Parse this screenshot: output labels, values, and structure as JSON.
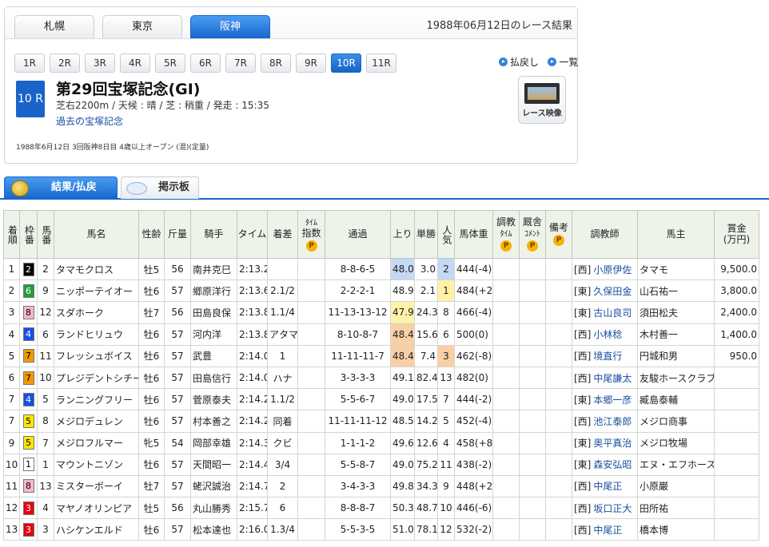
{
  "header": {
    "track_tabs": [
      {
        "label": "札幌",
        "active": false
      },
      {
        "label": "東京",
        "active": false
      },
      {
        "label": "阪神",
        "active": true
      }
    ],
    "result_date": "1988年06月12日のレース結果"
  },
  "race_nav": {
    "races": [
      "1R",
      "2R",
      "3R",
      "4R",
      "5R",
      "6R",
      "7R",
      "8R",
      "9R",
      "10R",
      "11R"
    ],
    "active_race": "10R",
    "payout_link": "払戻し",
    "list_link": "一覧"
  },
  "race": {
    "number": "10 R",
    "title": "第29回宝塚記念(GI)",
    "info": "芝右2200m / 天候 : 晴 / 芝 : 稍重 / 発走 : 15:35",
    "past_link": "過去の宝塚記念",
    "footer": "1988年6月12日 3回阪神8日目 4歳以上オープン (混)(定量)",
    "video_label": "レース映像"
  },
  "result_tabs": {
    "results": "結果/払戻",
    "board": "掲示板"
  },
  "table": {
    "headers": {
      "rank": "着順",
      "waku": "枠番",
      "umaban": "馬番",
      "horse": "馬名",
      "sexage": "性齢",
      "weight": "斤量",
      "jockey": "騎手",
      "time": "タイム",
      "margin": "着差",
      "time_index_1": "ﾀｲﾑ",
      "time_index_2": "指数",
      "passing": "通過",
      "last3f": "上り",
      "odds": "単勝",
      "pop": "人気",
      "body": "馬体重",
      "train_time_1": "調教",
      "train_time_2": "ﾀｲﾑ",
      "comment_1": "厩舎",
      "comment_2": "ｺﾒﾝﾄ",
      "remarks": "備考",
      "trainer": "調教師",
      "owner": "馬主",
      "prize_1": "賞金",
      "prize_2": "(万円)",
      "premium_badge": "P"
    },
    "waku_colors": {
      "1": {
        "bg": "#ffffff",
        "fg": "#000000"
      },
      "2": {
        "bg": "#000000",
        "fg": "#ffffff"
      },
      "3": {
        "bg": "#e60012",
        "fg": "#ffffff"
      },
      "4": {
        "bg": "#1450e6",
        "fg": "#ffffff"
      },
      "5": {
        "bg": "#ffe500",
        "fg": "#000000"
      },
      "6": {
        "bg": "#1e9e3a",
        "fg": "#ffffff"
      },
      "7": {
        "bg": "#f39800",
        "fg": "#000000"
      },
      "8": {
        "bg": "#f7b7c8",
        "fg": "#000000"
      }
    },
    "highlight_colors": {
      "blue": "#c5d9f5",
      "yellow": "#fff2a8",
      "orange": "#f9cfa6"
    },
    "rows": [
      {
        "rank": "1",
        "waku": "2",
        "umaban": "2",
        "horse": "タマモクロス",
        "sexage": "牡5",
        "weight": "56",
        "jockey": "南井克巳",
        "time": "2:13.2",
        "margin": "",
        "passing": "8-8-6-5",
        "last3f": "48.0",
        "last3f_hl": "blue",
        "odds": "3.0",
        "pop": "2",
        "pop_hl": "blue",
        "body": "444(-4)",
        "region": "[西]",
        "trainer": "小原伊佐",
        "owner": "タマモ",
        "prize": "9,500.0"
      },
      {
        "rank": "2",
        "waku": "6",
        "umaban": "9",
        "horse": "ニッポーテイオー",
        "sexage": "牡6",
        "weight": "57",
        "jockey": "郷原洋行",
        "time": "2:13.6",
        "margin": "2.1/2",
        "passing": "2-2-2-1",
        "last3f": "48.9",
        "last3f_hl": "",
        "odds": "2.1",
        "pop": "1",
        "pop_hl": "yellow",
        "body": "484(+2)",
        "region": "[東]",
        "trainer": "久保田金",
        "owner": "山石祐一",
        "prize": "3,800.0"
      },
      {
        "rank": "3",
        "waku": "8",
        "umaban": "12",
        "horse": "スダホーク",
        "sexage": "牡7",
        "weight": "56",
        "jockey": "田島良保",
        "time": "2:13.8",
        "margin": "1.1/4",
        "passing": "11-13-13-12",
        "last3f": "47.9",
        "last3f_hl": "yellow",
        "odds": "24.3",
        "pop": "8",
        "pop_hl": "",
        "body": "466(-4)",
        "region": "[東]",
        "trainer": "古山良司",
        "owner": "須田松夫",
        "prize": "2,400.0"
      },
      {
        "rank": "4",
        "waku": "4",
        "umaban": "6",
        "horse": "ランドヒリュウ",
        "sexage": "牡6",
        "weight": "57",
        "jockey": "河内洋",
        "time": "2:13.8",
        "margin": "アタマ",
        "passing": "8-10-8-7",
        "last3f": "48.4",
        "last3f_hl": "orange",
        "odds": "15.6",
        "pop": "6",
        "pop_hl": "",
        "body": "500(0)",
        "region": "[西]",
        "trainer": "小林稔",
        "owner": "木村善一",
        "prize": "1,400.0"
      },
      {
        "rank": "5",
        "waku": "7",
        "umaban": "11",
        "horse": "フレッシュボイス",
        "sexage": "牡6",
        "weight": "57",
        "jockey": "武豊",
        "time": "2:14.0",
        "margin": "1",
        "passing": "11-11-11-7",
        "last3f": "48.4",
        "last3f_hl": "orange",
        "odds": "7.4",
        "pop": "3",
        "pop_hl": "orange",
        "body": "462(-8)",
        "region": "[西]",
        "trainer": "境直行",
        "owner": "円城和男",
        "prize": "950.0"
      },
      {
        "rank": "6",
        "waku": "7",
        "umaban": "10",
        "horse": "プレジデントシチー",
        "sexage": "牡6",
        "weight": "57",
        "jockey": "田島信行",
        "time": "2:14.0",
        "margin": "ハナ",
        "passing": "3-3-3-3",
        "last3f": "49.1",
        "last3f_hl": "",
        "odds": "82.4",
        "pop": "13",
        "pop_hl": "",
        "body": "482(0)",
        "region": "[西]",
        "trainer": "中尾謙太",
        "owner": "友駿ホースクラブ",
        "prize": ""
      },
      {
        "rank": "7",
        "waku": "4",
        "umaban": "5",
        "horse": "ランニングフリー",
        "sexage": "牡6",
        "weight": "57",
        "jockey": "菅原泰夫",
        "time": "2:14.2",
        "margin": "1.1/2",
        "passing": "5-5-6-7",
        "last3f": "49.0",
        "last3f_hl": "",
        "odds": "17.5",
        "pop": "7",
        "pop_hl": "",
        "body": "444(-2)",
        "region": "[東]",
        "trainer": "本郷一彦",
        "owner": "臧島泰輔",
        "prize": ""
      },
      {
        "rank": "7",
        "waku": "5",
        "umaban": "8",
        "horse": "メジロデュレン",
        "sexage": "牡6",
        "weight": "57",
        "jockey": "村本善之",
        "time": "2:14.2",
        "margin": "同着",
        "passing": "11-11-11-12",
        "last3f": "48.5",
        "last3f_hl": "",
        "odds": "14.2",
        "pop": "5",
        "pop_hl": "",
        "body": "452(-4)",
        "region": "[西]",
        "trainer": "池江泰郎",
        "owner": "メジロ商事",
        "prize": ""
      },
      {
        "rank": "9",
        "waku": "5",
        "umaban": "7",
        "horse": "メジロフルマー",
        "sexage": "牝5",
        "weight": "54",
        "jockey": "岡部幸雄",
        "time": "2:14.3",
        "margin": "クビ",
        "passing": "1-1-1-2",
        "last3f": "49.6",
        "last3f_hl": "",
        "odds": "12.6",
        "pop": "4",
        "pop_hl": "",
        "body": "458(+8)",
        "region": "[東]",
        "trainer": "奥平真治",
        "owner": "メジロ牧場",
        "prize": ""
      },
      {
        "rank": "10",
        "waku": "1",
        "umaban": "1",
        "horse": "マウントニゾン",
        "sexage": "牡6",
        "weight": "57",
        "jockey": "天間昭一",
        "time": "2:14.4",
        "margin": "3/4",
        "passing": "5-5-8-7",
        "last3f": "49.0",
        "last3f_hl": "",
        "odds": "75.2",
        "pop": "11",
        "pop_hl": "",
        "body": "438(-2)",
        "region": "[東]",
        "trainer": "森安弘昭",
        "owner": "エヌ・エフホース",
        "prize": ""
      },
      {
        "rank": "11",
        "waku": "8",
        "umaban": "13",
        "horse": "ミスターボーイ",
        "sexage": "牡7",
        "weight": "57",
        "jockey": "蛯沢誠治",
        "time": "2:14.7",
        "margin": "2",
        "passing": "3-4-3-3",
        "last3f": "49.8",
        "last3f_hl": "",
        "odds": "34.3",
        "pop": "9",
        "pop_hl": "",
        "body": "448(+2)",
        "region": "[西]",
        "trainer": "中尾正",
        "owner": "小原巌",
        "prize": ""
      },
      {
        "rank": "12",
        "waku": "3",
        "umaban": "4",
        "horse": "マヤノオリンピア",
        "sexage": "牡5",
        "weight": "56",
        "jockey": "丸山勝秀",
        "time": "2:15.7",
        "margin": "6",
        "passing": "8-8-8-7",
        "last3f": "50.3",
        "last3f_hl": "",
        "odds": "48.7",
        "pop": "10",
        "pop_hl": "",
        "body": "446(-6)",
        "region": "[西]",
        "trainer": "坂口正大",
        "owner": "田所祐",
        "prize": ""
      },
      {
        "rank": "13",
        "waku": "3",
        "umaban": "3",
        "horse": "ハシケンエルド",
        "sexage": "牡6",
        "weight": "57",
        "jockey": "松本達也",
        "time": "2:16.0",
        "margin": "1.3/4",
        "passing": "5-5-3-5",
        "last3f": "51.0",
        "last3f_hl": "",
        "odds": "78.1",
        "pop": "12",
        "pop_hl": "",
        "body": "532(-2)",
        "region": "[西]",
        "trainer": "中尾正",
        "owner": "橋本博",
        "prize": ""
      }
    ]
  }
}
